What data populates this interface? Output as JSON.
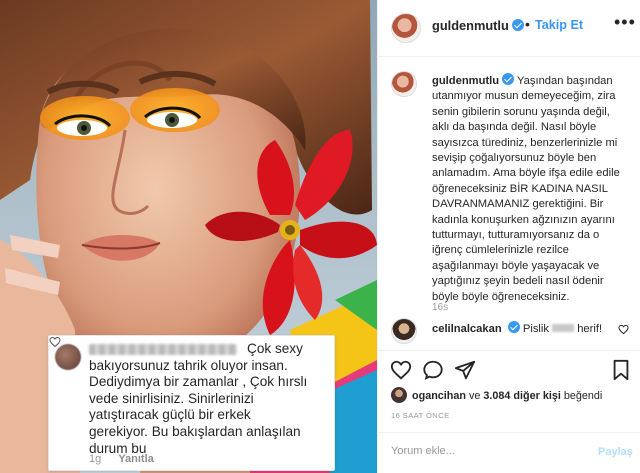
{
  "post": {
    "username": "guldenmutlu",
    "follow_label": "Takip Et",
    "more_label": "•••",
    "caption_username": "guldenmutlu",
    "caption_text": "Yaşından başından utanmıyor musun demeyeceğim, zira senin gibilerin sorunu yaşında değil, aklı da başında değil. Nasıl böyle sayısızca türediniz, benzerlerinizle mi sevişip çoğalıyorsunuz böyle ben anlamadım. Ama böyle ifşa edile edile öğreneceksiniz BİR KADINA NASIL DAVRANMAMANIZ gerektiğini. Bir kadınla konuşurken ağzınızın ayarını tutturmayı, tutturamıyorsanız da o iğrenç cümlelerinizle rezilce aşağılanmayı böyle yaşayacak ve yaptığınız şeyin bedeli nasıl ödenir böyle böyle öğreneceksiniz.",
    "caption_time": "16s",
    "comment_username": "celilnalcakan",
    "comment_text_before": "Pislik",
    "comment_text_after": "herif!",
    "likes_user": "ogancihan",
    "likes_connector": "ve",
    "likes_count": "3.084 diğer kişi",
    "likes_suffix": "beğendi",
    "post_time": "16 SAAT ÖNCE",
    "comment_placeholder": "Yorum ekle...",
    "post_button": "Paylaş"
  },
  "overlay_comment": {
    "text": "Çok sexy bakıyorsunuz tahrik oluyor insan. Dediydimya bir zamanlar , Çok hırslı vede sinirlisiniz. Sinirlerinizi yatıştıracak güçlü bir erkek gerekiyor. Bu bakışlardan anlaşılan durum bu",
    "time": "1g",
    "reply_label": "Yanıtla"
  },
  "icons": {
    "verified": "verified-badge-icon",
    "heart": "heart-icon",
    "comment": "comment-icon",
    "share": "share-icon",
    "bookmark": "bookmark-icon"
  },
  "colors": {
    "accent": "#3897f0",
    "flower": "#d8121b",
    "eyeshadow": "#f39a1e"
  }
}
